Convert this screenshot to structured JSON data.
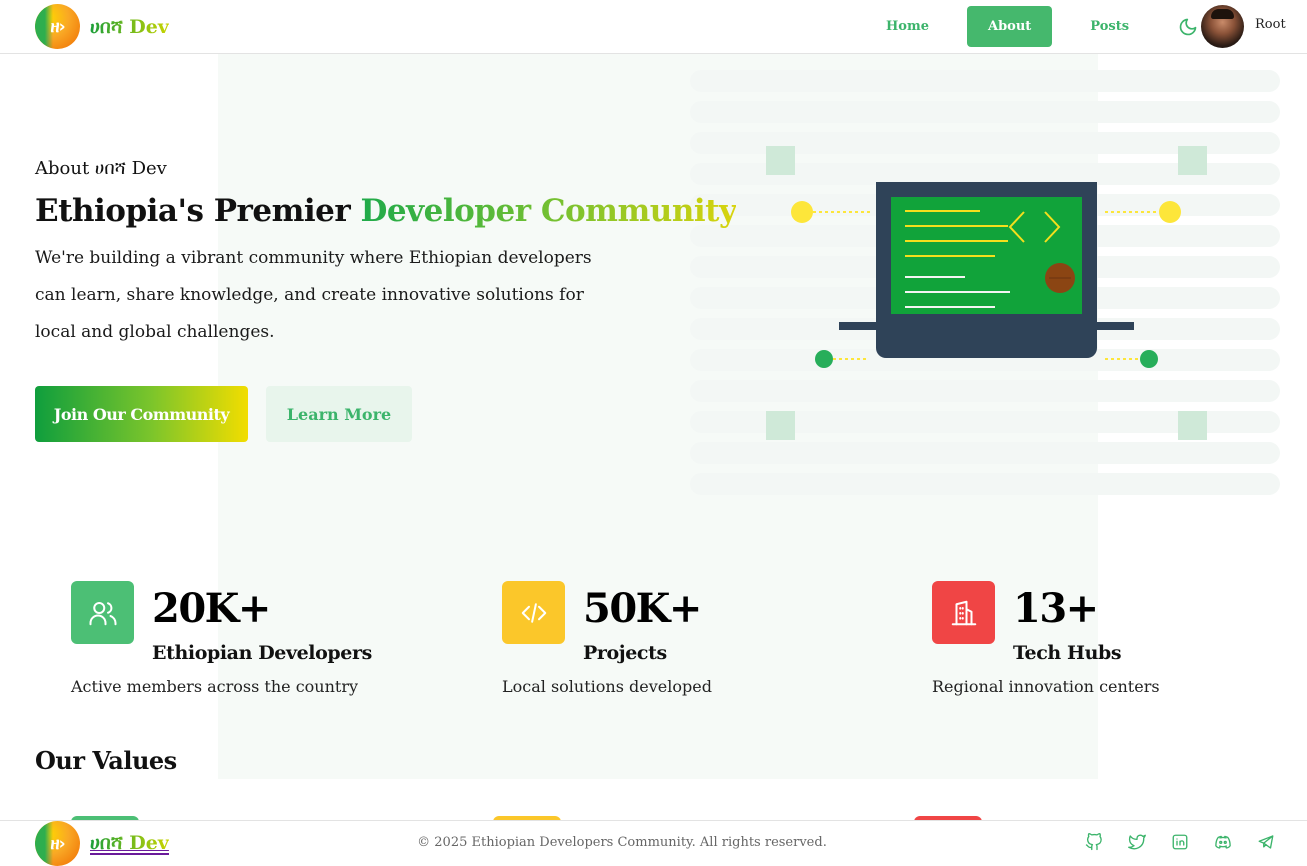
{
  "header": {
    "brand": "ሀበሻ Dev",
    "logo_glyph": "ዘ›",
    "nav": [
      "Home",
      "About",
      "Posts"
    ],
    "active_nav": "About",
    "theme_toggle_icon": "moon-icon",
    "user_name": "Root"
  },
  "hero": {
    "kicker": "About ሀበሻ Dev",
    "title_plain": "Ethiopia's Premier ",
    "title_highlight": "Developer Community",
    "description": "We're building a vibrant community where Ethiopian developers can learn, share knowledge, and create innovative solutions for local and global challenges.",
    "primary_button": "Join Our Community",
    "secondary_button": "Learn More"
  },
  "stats": [
    {
      "value": "20K+",
      "label": "Ethiopian Developers",
      "description": "Active members across the country",
      "icon": "users-icon",
      "color": "#4cbf75"
    },
    {
      "value": "50K+",
      "label": "Projects",
      "description": "Local solutions developed",
      "icon": "code-icon",
      "color": "#fbc72a"
    },
    {
      "value": "13+",
      "label": "Tech Hubs",
      "description": "Regional innovation centers",
      "icon": "building-icon",
      "color": "#f04545"
    }
  ],
  "values_heading": "Our Values",
  "footer": {
    "brand": "ሀበሻ Dev",
    "copyright": "© 2025 Ethiopian Developers Community. All rights reserved.",
    "socials": [
      "github-icon",
      "twitter-icon",
      "linkedin-icon",
      "discord-icon",
      "telegram-icon"
    ]
  },
  "colors": {
    "accent_green": "#45b86d",
    "accent_yellow": "#fbc72a",
    "accent_red": "#f04545"
  }
}
